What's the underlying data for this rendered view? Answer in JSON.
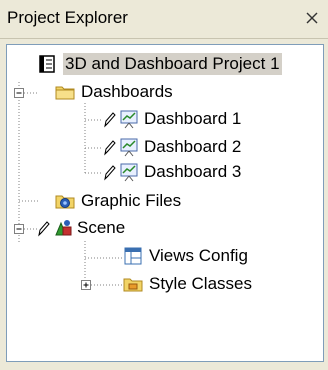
{
  "panel": {
    "title": "Project Explorer",
    "close_glyph": "×"
  },
  "tree": {
    "root": {
      "label": "3D and Dashboard Project 1",
      "icon": "project-book-icon",
      "selected": true
    },
    "dashboards": {
      "label": "Dashboards",
      "icon": "folder-icon",
      "expanded": true
    },
    "dashboard_1": {
      "label": "Dashboard 1",
      "icon": "dashboard-chart-icon",
      "edit_icon": "pencil-icon"
    },
    "dashboard_2": {
      "label": "Dashboard 2",
      "icon": "dashboard-chart-icon",
      "edit_icon": "pencil-icon"
    },
    "dashboard_3": {
      "label": "Dashboard 3",
      "icon": "dashboard-chart-icon",
      "edit_icon": "pencil-icon"
    },
    "graphic_files": {
      "label": "Graphic Files",
      "icon": "graphic-files-icon"
    },
    "scene": {
      "label": "Scene",
      "icon": "scene-shapes-icon",
      "edit_icon": "pencil-icon",
      "expanded": true
    },
    "views_config": {
      "label": "Views Config",
      "icon": "views-config-icon"
    },
    "style_classes": {
      "label": "Style Classes",
      "icon": "style-folder-icon",
      "expanded": false
    }
  },
  "colors": {
    "panel_bg": "#ece9d8",
    "tree_bg": "#ffffff",
    "selection": "#d4d0c8",
    "folder": "#f2d467",
    "guide": "#808080"
  }
}
